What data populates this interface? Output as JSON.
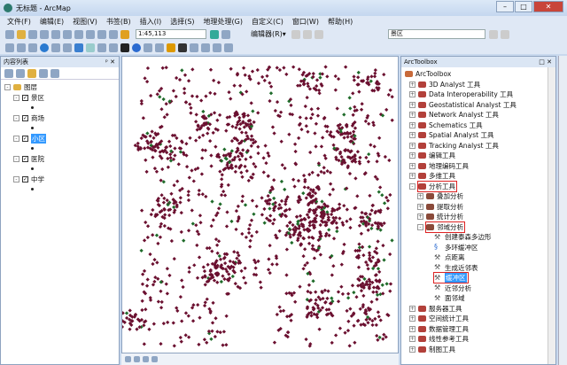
{
  "window": {
    "title": "无标题 - ArcMap"
  },
  "menu": [
    "文件(F)",
    "编辑(E)",
    "视图(V)",
    "书签(B)",
    "插入(I)",
    "选择(S)",
    "地理处理(G)",
    "自定义(C)",
    "窗口(W)",
    "帮助(H)"
  ],
  "toolbar": {
    "scale": "1:45,113",
    "editor_label": "编辑器(R)▾",
    "target_layer": "景区"
  },
  "toc": {
    "title": "内容列表",
    "root": "图层",
    "layers": [
      {
        "name": "景区",
        "checked": true,
        "selected": false
      },
      {
        "name": "商场",
        "checked": true,
        "selected": false
      },
      {
        "name": "小区",
        "checked": true,
        "selected": true
      },
      {
        "name": "医院",
        "checked": true,
        "selected": false
      },
      {
        "name": "中学",
        "checked": true,
        "selected": false
      }
    ]
  },
  "map": {
    "colors": {
      "primary": "#6b1030",
      "secondary": "#1f6b2a"
    }
  },
  "toolbox": {
    "title": "ArcToolbox",
    "root": "ArcToolbox",
    "items": [
      {
        "label": "3D Analyst 工具",
        "level": 1,
        "type": "box",
        "exp": "+"
      },
      {
        "label": "Data Interoperability 工具",
        "level": 1,
        "type": "box",
        "exp": "+"
      },
      {
        "label": "Geostatistical Analyst 工具",
        "level": 1,
        "type": "box",
        "exp": "+"
      },
      {
        "label": "Network Analyst 工具",
        "level": 1,
        "type": "box",
        "exp": "+"
      },
      {
        "label": "Schematics 工具",
        "level": 1,
        "type": "box",
        "exp": "+"
      },
      {
        "label": "Spatial Analyst 工具",
        "level": 1,
        "type": "box",
        "exp": "+"
      },
      {
        "label": "Tracking Analyst 工具",
        "level": 1,
        "type": "box",
        "exp": "+"
      },
      {
        "label": "编辑工具",
        "level": 1,
        "type": "box",
        "exp": "+"
      },
      {
        "label": "地理编码工具",
        "level": 1,
        "type": "box",
        "exp": "+"
      },
      {
        "label": "多维工具",
        "level": 1,
        "type": "box",
        "exp": "+"
      },
      {
        "label": "分析工具",
        "level": 1,
        "type": "box",
        "exp": "-",
        "highlight": true
      },
      {
        "label": "叠加分析",
        "level": 2,
        "type": "set",
        "exp": "+"
      },
      {
        "label": "提取分析",
        "level": 2,
        "type": "set",
        "exp": "+"
      },
      {
        "label": "统计分析",
        "level": 2,
        "type": "set",
        "exp": "+"
      },
      {
        "label": "邻域分析",
        "level": 2,
        "type": "set",
        "exp": "-",
        "highlight": true
      },
      {
        "label": "创建泰森多边形",
        "level": 3,
        "type": "tool"
      },
      {
        "label": "多环缓冲区",
        "level": 3,
        "type": "script"
      },
      {
        "label": "点距离",
        "level": 3,
        "type": "tool"
      },
      {
        "label": "生成近邻表",
        "level": 3,
        "type": "tool"
      },
      {
        "label": "缓冲区",
        "level": 3,
        "type": "tool",
        "highlight": true,
        "selected": true
      },
      {
        "label": "近邻分析",
        "level": 3,
        "type": "tool"
      },
      {
        "label": "面邻域",
        "level": 3,
        "type": "tool"
      },
      {
        "label": "服务器工具",
        "level": 1,
        "type": "box",
        "exp": "+"
      },
      {
        "label": "空间统计工具",
        "level": 1,
        "type": "box",
        "exp": "+"
      },
      {
        "label": "数据管理工具",
        "level": 1,
        "type": "box",
        "exp": "+"
      },
      {
        "label": "线性参考工具",
        "level": 1,
        "type": "box",
        "exp": "+"
      },
      {
        "label": "制图工具",
        "level": 1,
        "type": "box",
        "exp": "+"
      }
    ]
  }
}
